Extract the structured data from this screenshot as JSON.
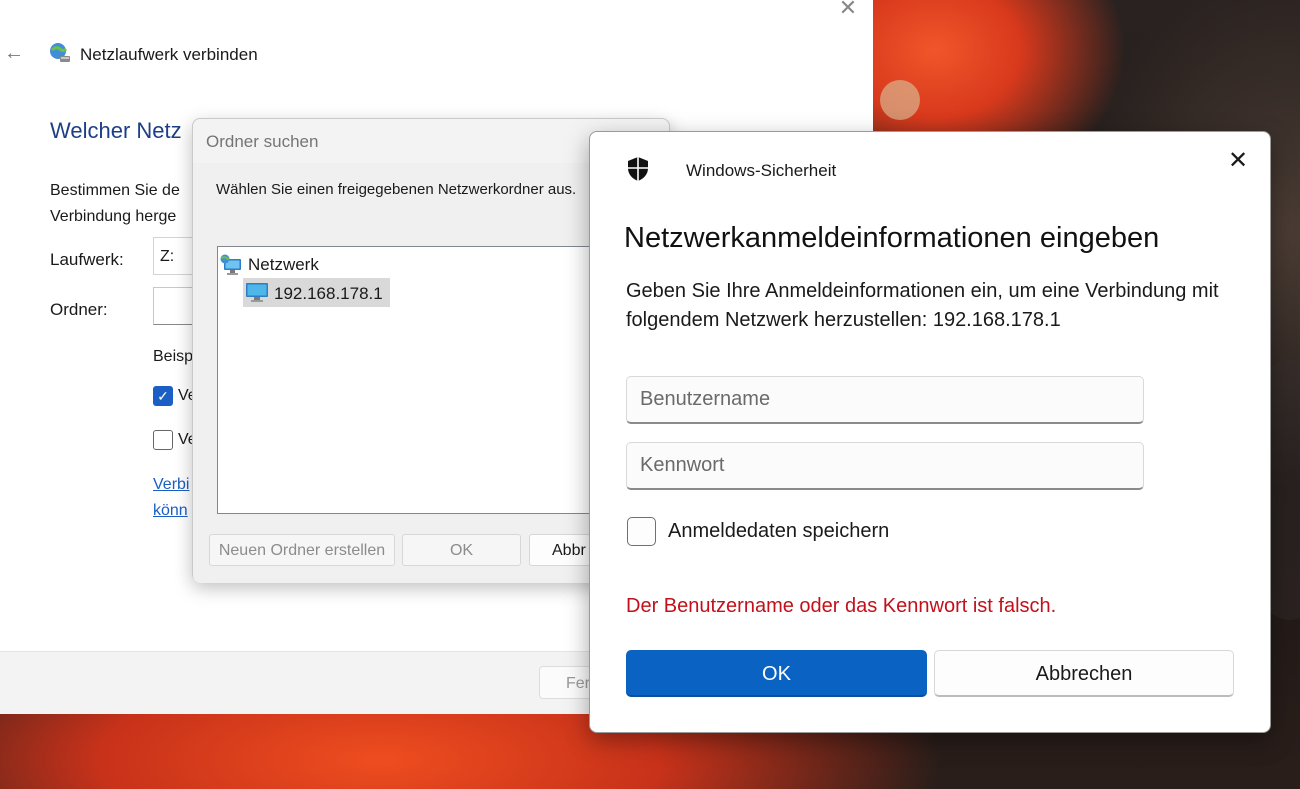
{
  "wizard": {
    "title": "Netzlaufwerk verbinden",
    "heading": "Welcher Netz",
    "description_line1": "Bestimmen Sie de",
    "description_line2": "Verbindung herge",
    "drive_label": "Laufwerk:",
    "drive_value": "Z:",
    "folder_label": "Ordner:",
    "folder_value": "",
    "example_text": "Beisp",
    "reconnect_label": "Ve",
    "reconnect_checked": true,
    "other_credentials_label": "Ve",
    "other_credentials_checked": false,
    "link_line1": "Verbi",
    "link_line2": "könn",
    "finish_button": "Fer"
  },
  "browse": {
    "title": "Ordner suchen",
    "instruction": "Wählen Sie einen freigegebenen Netzwerkordner aus.",
    "tree": {
      "root": "Netzwerk",
      "child": "192.168.178.1"
    },
    "new_folder_button": "Neuen Ordner erstellen",
    "ok_button": "OK",
    "cancel_button": "Abbr"
  },
  "security": {
    "app_title": "Windows-Sicherheit",
    "heading": "Netzwerkanmeldeinformationen eingeben",
    "message": "Geben Sie Ihre Anmeldeinformationen ein, um eine Verbindung mit folgendem Netzwerk herzustellen: 192.168.178.1",
    "username_placeholder": "Benutzername",
    "password_placeholder": "Kennwort",
    "save_credentials_label": "Anmeldedaten speichern",
    "save_credentials_checked": false,
    "error_text": "Der Benutzername oder das Kennwort ist falsch.",
    "ok_button": "OK",
    "cancel_button": "Abbrechen"
  },
  "colors": {
    "accent": "#0a63c2",
    "error": "#c2111b",
    "heading_blue": "#1e3e8a",
    "link": "#1b5fc4"
  }
}
